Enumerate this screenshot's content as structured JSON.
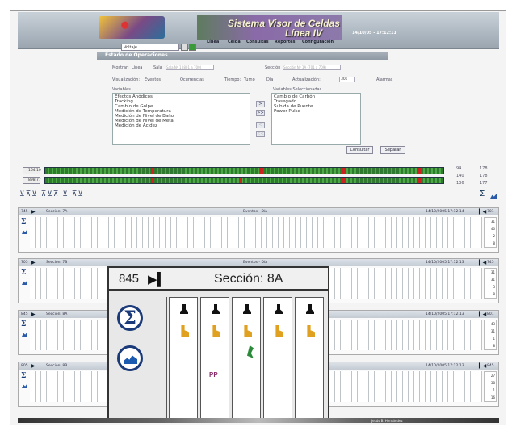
{
  "app": {
    "title_1": "Sistema Visor de Celdas",
    "title_2": "Línea IV",
    "datetime": "14/10/05 - 17:12:11"
  },
  "menu": [
    "Línea",
    "Celda",
    "Consultas",
    "Reportes",
    "Configuración"
  ],
  "toolbar": {
    "select_value": "Voltaje"
  },
  "panel": {
    "title": "Estado de Operaciones",
    "mostrar_label": "Mostrar:",
    "opt_linea": "Línea",
    "opt_sala": "Sala",
    "sala_value": "Sala Nº 1 (801 a 700)",
    "opt_seccion": "Sección",
    "seccion_value": "Sección Nº 1A (701 a 709)",
    "visualizacion_label": "Visualización:",
    "opt_eventos": "Eventos",
    "opt_ocurrencias": "Ocurrencias",
    "tiempo_label": "Tiempo:",
    "opt_turno": "Turno",
    "opt_dia": "Día",
    "actualizacion_label": "Actualización:",
    "actualizacion_value": "30s",
    "alarmas_label": "Alarmas",
    "variables_label": "Variables",
    "selected_label": "Variables Seleccionadas",
    "variables": [
      "Efectos Anódicos",
      "Tracking",
      "Cambio de Golpe",
      "Medición de Temperatura",
      "Medición de Nivel de Baño",
      "Medición de Nivel de Metal",
      "Medición de Acidez"
    ],
    "selected": [
      "Cambio de Carbón",
      "Trasegado",
      "Subida de Puente",
      "Power Pulse"
    ],
    "consultar": "Consultar",
    "separar": "Separar"
  },
  "meters": [
    {
      "label": "164.10"
    },
    {
      "label": "898.77"
    }
  ],
  "meter_side": [
    [
      "94",
      "178"
    ],
    [
      "140",
      "178"
    ],
    [
      "136",
      "177"
    ]
  ],
  "sections": [
    {
      "num": "745",
      "name": "Sección: 7A",
      "mode": "Eventos - Día",
      "stamp": "14/10/2005 17:12:14",
      "end": "701",
      "side": [
        "31",
        "40",
        "2",
        "8"
      ]
    },
    {
      "num": "705",
      "name": "Sección: 7B",
      "mode": "Eventos - Día",
      "stamp": "14/10/2005 17:12:13",
      "end": "745",
      "side": [
        "31",
        "31",
        "3",
        "8"
      ]
    },
    {
      "num": "845",
      "name": "Sección: 8A",
      "mode": "",
      "stamp": "14/10/2005 17:12:13",
      "end": "801",
      "side": [
        "43",
        "31",
        "1",
        "8"
      ]
    },
    {
      "num": "805",
      "name": "Sección: 8B",
      "mode": "",
      "stamp": "14/10/2005 17:12:13",
      "end": "845",
      "side": [
        "27",
        "38",
        "1",
        "16"
      ]
    }
  ],
  "zoom": {
    "num": "845",
    "title": "Sección: 8A"
  },
  "footer_user": "Jesús B. Hernández"
}
